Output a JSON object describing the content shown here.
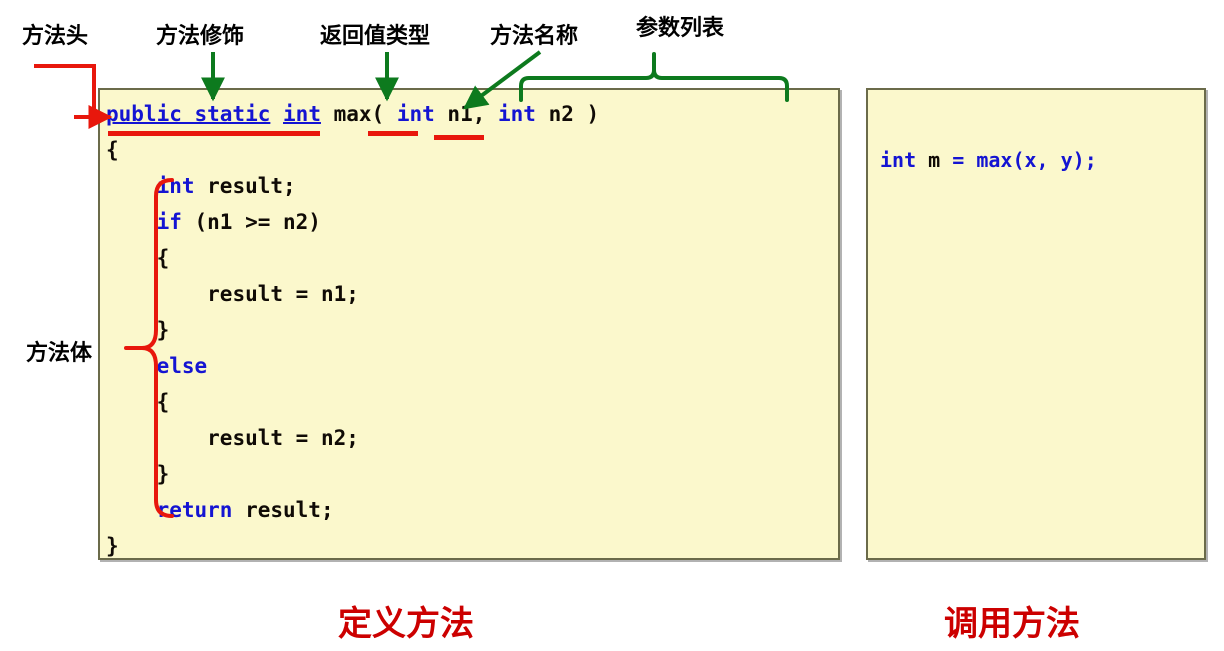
{
  "diagram": {
    "title_note": "Java method definition and invocation annotated diagram",
    "colors": {
      "panel_fill": "#fbf8cc",
      "panel_border": "#6b6b4a",
      "keyword_blue": "#1414d2",
      "identifier_black": "#100b06",
      "annotation_red": "#e8170c",
      "annotation_green": "#0d7a1e",
      "caption_red": "#cc0000"
    },
    "annotations": {
      "method_head": "方法头",
      "method_modifier": "方法修饰",
      "return_type": "返回值类型",
      "method_name": "方法名称",
      "parameter_list": "参数列表",
      "method_body": "方法体"
    },
    "captions": {
      "define": "定义方法",
      "call": "调用方法"
    }
  },
  "define_panel": {
    "lines": [
      {
        "indent": 0,
        "tokens": [
          {
            "text": "public static",
            "style": "kwu"
          },
          {
            "text": " ",
            "style": "id"
          },
          {
            "text": "int",
            "style": "kwu"
          },
          {
            "text": " ",
            "style": "id"
          },
          {
            "text": "max( ",
            "style": "id"
          },
          {
            "text": "int",
            "style": "kw"
          },
          {
            "text": " n1, ",
            "style": "id"
          },
          {
            "text": "int",
            "style": "kw"
          },
          {
            "text": " n2 )",
            "style": "id"
          }
        ]
      },
      {
        "indent": 0,
        "tokens": [
          {
            "text": "{",
            "style": "id"
          }
        ]
      },
      {
        "indent": 1,
        "tokens": [
          {
            "text": "int",
            "style": "kw"
          },
          {
            "text": " result;",
            "style": "id"
          }
        ]
      },
      {
        "indent": 1,
        "tokens": [
          {
            "text": "if",
            "style": "kw"
          },
          {
            "text": " (n1 >= n2)",
            "style": "id"
          }
        ]
      },
      {
        "indent": 1,
        "tokens": [
          {
            "text": "{",
            "style": "id"
          }
        ]
      },
      {
        "indent": 2,
        "tokens": [
          {
            "text": "result = n1;",
            "style": "id"
          }
        ]
      },
      {
        "indent": 1,
        "tokens": [
          {
            "text": "}",
            "style": "id"
          }
        ]
      },
      {
        "indent": 1,
        "tokens": [
          {
            "text": "else",
            "style": "kw"
          }
        ]
      },
      {
        "indent": 1,
        "tokens": [
          {
            "text": "{",
            "style": "id"
          }
        ]
      },
      {
        "indent": 2,
        "tokens": [
          {
            "text": "result = n2;",
            "style": "id"
          }
        ]
      },
      {
        "indent": 1,
        "tokens": [
          {
            "text": "}",
            "style": "id"
          }
        ]
      },
      {
        "indent": 1,
        "tokens": [
          {
            "text": "return",
            "style": "kw"
          },
          {
            "text": " result;",
            "style": "id"
          }
        ]
      },
      {
        "indent": 0,
        "tokens": [
          {
            "text": "}",
            "style": "id"
          }
        ]
      }
    ],
    "plain_text": "public static int max( int n1, int n2 )\n{\n    int result;\n    if (n1 >= n2)\n    {\n        result = n1;\n    }\n    else\n    {\n        result = n2;\n    }\n    return result;\n}"
  },
  "call_panel": {
    "lines": [
      {
        "indent": 0,
        "tokens": [
          {
            "text": "int",
            "style": "kw"
          },
          {
            "text": " m",
            "style": "id"
          },
          {
            "text": " = max(x, y);",
            "style": "kw"
          }
        ]
      }
    ],
    "plain_text": "int m = max(x, y);"
  }
}
